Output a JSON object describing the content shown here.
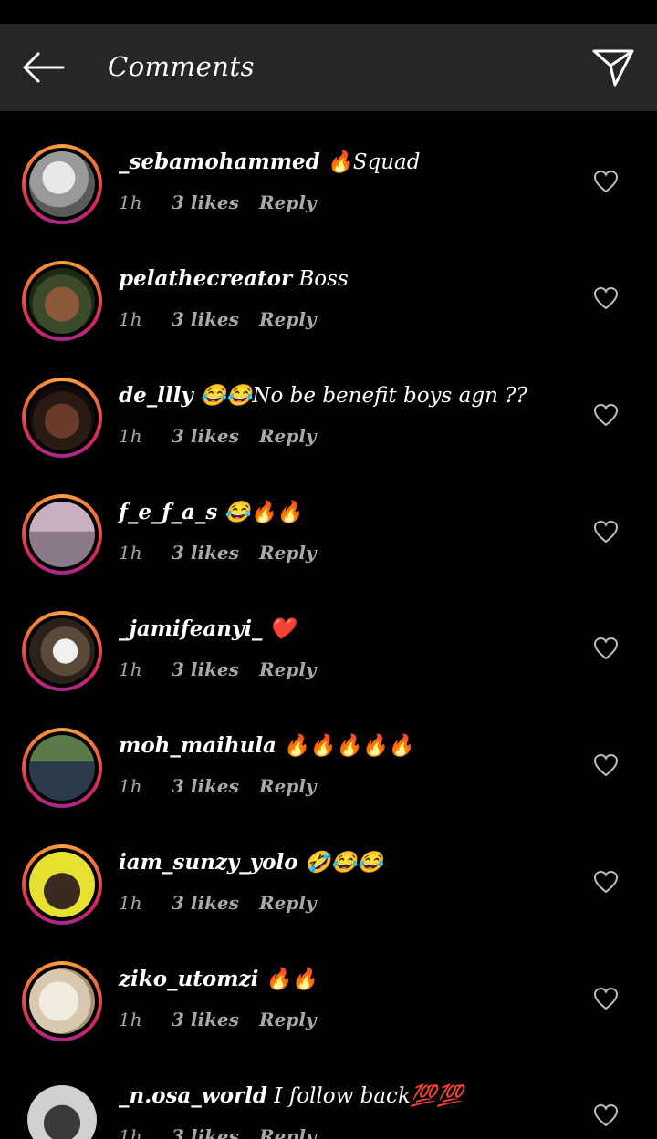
{
  "header": {
    "title": "Comments"
  },
  "comments": [
    {
      "username": "_sebamohammed",
      "text": "🔥Squad",
      "time": "1h",
      "likes": "3 likes",
      "reply": "Reply"
    },
    {
      "username": "pelathecreator",
      "text": "Boss",
      "time": "1h",
      "likes": "3 likes",
      "reply": "Reply"
    },
    {
      "username": "de_llly",
      "text": "😂😂No be benefit boys agn ??",
      "time": "1h",
      "likes": "3 likes",
      "reply": "Reply"
    },
    {
      "username": "f_e_f_a_s",
      "text": "😂🔥🔥",
      "time": "1h",
      "likes": "3 likes",
      "reply": "Reply"
    },
    {
      "username": "_jamifeanyi_",
      "text": "❤️",
      "time": "1h",
      "likes": "3 likes",
      "reply": "Reply"
    },
    {
      "username": "moh_maihula",
      "text": "🔥🔥🔥🔥🔥",
      "time": "1h",
      "likes": "3 likes",
      "reply": "Reply"
    },
    {
      "username": "iam_sunzy_yolo",
      "text": "🤣😂😂",
      "time": "1h",
      "likes": "3 likes",
      "reply": "Reply"
    },
    {
      "username": "ziko_utomzi",
      "text": "🔥🔥",
      "time": "1h",
      "likes": "3 likes",
      "reply": "Reply"
    },
    {
      "username": "_n.osa_world",
      "text": "I follow back💯💯",
      "time": "1h",
      "likes": "3 likes",
      "reply": "Reply"
    }
  ],
  "icons": {
    "back": "arrow-left-icon",
    "send": "paper-plane-icon",
    "like": "heart-outline-icon"
  },
  "colors": {
    "background": "#000000",
    "header": "#262626",
    "meta": "#a8a8a8",
    "story_ring": [
      "#f9a33b",
      "#d3285e",
      "#a52a8f"
    ]
  }
}
